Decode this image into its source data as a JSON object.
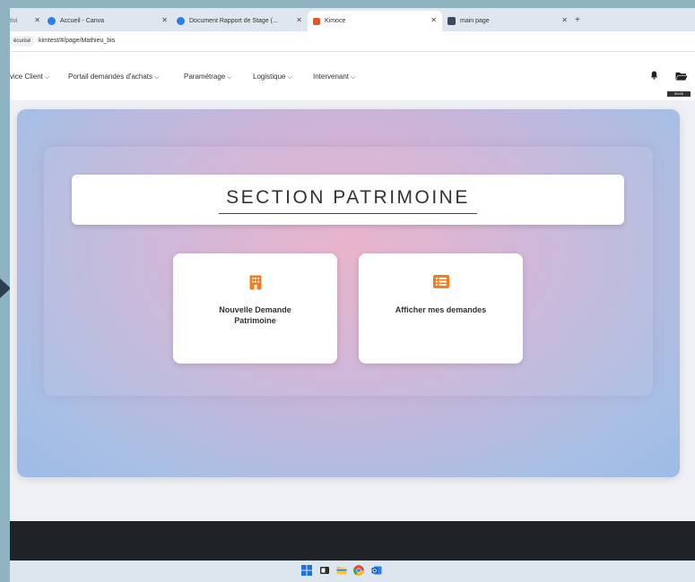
{
  "browser": {
    "tabs": [
      {
        "label": "tivi",
        "active": false
      },
      {
        "label": "Accueil - Canva",
        "active": false
      },
      {
        "label": "Document Rapport de Stage (...",
        "active": false
      },
      {
        "label": "Kimoce",
        "active": true
      },
      {
        "label": "main page",
        "active": false
      }
    ],
    "new_tab": "+",
    "secure_label": "écurisé",
    "url": "kimtest/#/page/Mathieu_bis"
  },
  "nav": {
    "items": [
      "vice Client",
      "Portail demandes d'achats",
      "Paramétrage",
      "Logistique",
      "Intervenant"
    ],
    "badge": "00:00"
  },
  "section": {
    "title": "SECTION PATRIMOINE",
    "actions": [
      {
        "label": "Nouvelle Demande Patrimoine",
        "icon": "building-icon"
      },
      {
        "label": "Afficher mes demandes",
        "icon": "list-icon"
      }
    ]
  },
  "colors": {
    "accent": "#f57c1f",
    "footer": "#1f2226",
    "taskbar": "#dde6ef"
  }
}
